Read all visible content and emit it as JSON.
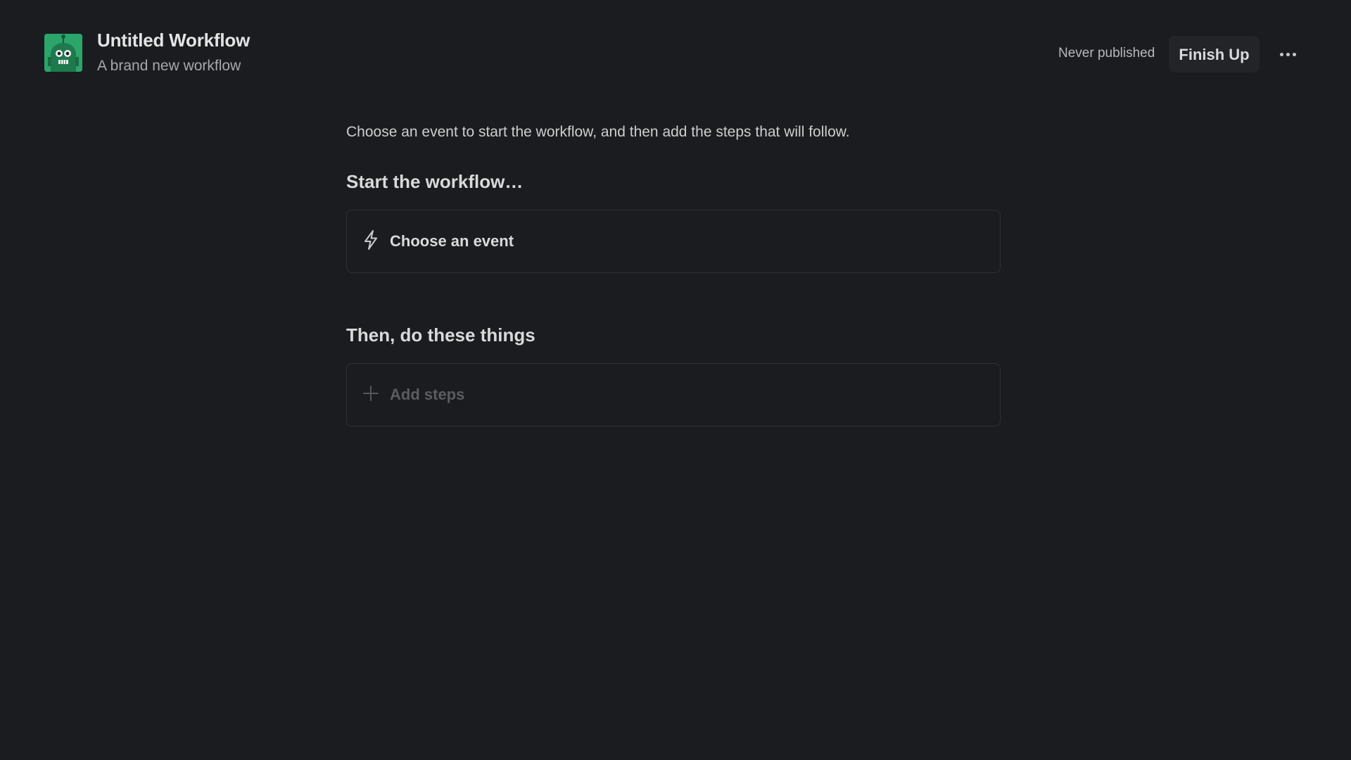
{
  "header": {
    "icon": "robot-workflow-icon",
    "title": "Untitled Workflow",
    "subtitle": "A brand new workflow",
    "publish_status": "Never published",
    "finish_label": "Finish Up",
    "more_icon": "more-horizontal-icon"
  },
  "main": {
    "intro": "Choose an event to start the workflow, and then add the steps that will follow.",
    "start_heading": "Start the workflow…",
    "event_card": {
      "icon": "lightning-icon",
      "label": "Choose an event"
    },
    "steps_heading": "Then, do these things",
    "steps_card": {
      "icon": "plus-icon",
      "label": "Add steps"
    }
  },
  "colors": {
    "background": "#1b1c1f",
    "brand_green": "#2ba56a",
    "card_border": "#2f3034",
    "button_bg": "#232427"
  }
}
